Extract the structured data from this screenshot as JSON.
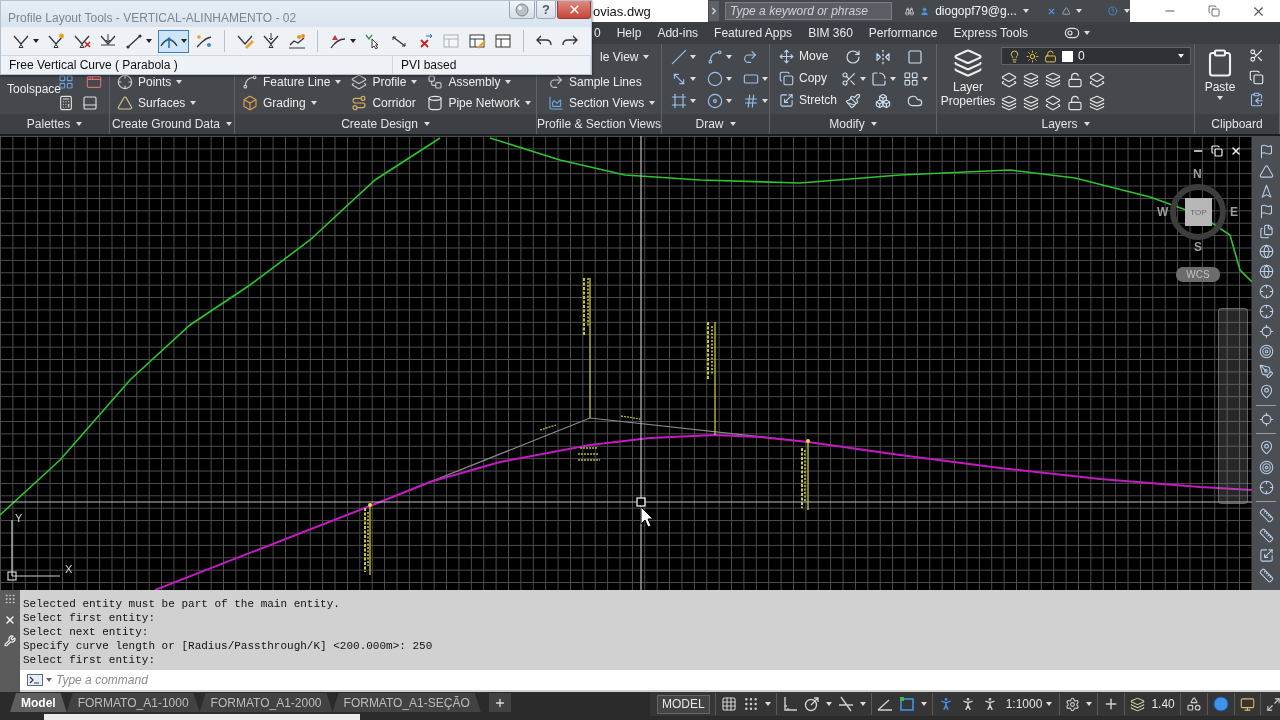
{
  "title_bar": {
    "file_name": "ovias.dwg",
    "search": {
      "placeholder": "Type a keyword or phrase"
    },
    "user": "diogopf79@g..."
  },
  "ribbon_tabs": [
    {
      "label": "0",
      "selected": false
    },
    {
      "label": "Help",
      "selected": false
    },
    {
      "label": "Add-ins",
      "selected": false
    },
    {
      "label": "Featured Apps",
      "selected": false
    },
    {
      "label": "BIM 360",
      "selected": false
    },
    {
      "label": "Performance",
      "selected": false
    },
    {
      "label": "Express Tools",
      "selected": false
    }
  ],
  "ribbon_panels": [
    {
      "kind": "palettes",
      "title": "Palettes",
      "menu": true,
      "items": [
        {
          "label": "Toolspace"
        }
      ]
    },
    {
      "kind": "columns",
      "title": "Create Ground Data",
      "menu": true,
      "columns": [
        [
          {
            "label": "Points",
            "dropdown": true
          },
          {
            "label": "Surfaces",
            "dropdown": true
          }
        ]
      ]
    },
    {
      "kind": "columns",
      "title": "Create Design",
      "menu": true,
      "columns": [
        [
          {
            "label": "Feature Line",
            "dropdown": true
          },
          {
            "label": "Grading",
            "dropdown": true
          }
        ],
        [
          {
            "label": "Profile",
            "dropdown": true
          },
          {
            "label": "Corridor",
            "dropdown": false
          }
        ],
        [
          {
            "label": "Assembly",
            "dropdown": true
          },
          {
            "label": "Pipe Network",
            "dropdown": true
          }
        ]
      ]
    },
    {
      "kind": "rows",
      "title": "Profile & Section Views",
      "menu": false,
      "items": [
        {
          "label": "le View",
          "dropdown": true
        },
        {
          "label": "Sample Lines",
          "dropdown": false
        },
        {
          "label": "Section Views",
          "dropdown": true
        }
      ]
    },
    {
      "kind": "draw",
      "title": "Draw",
      "menu": true
    },
    {
      "kind": "modify",
      "title": "Modify",
      "menu": true,
      "items": [
        {
          "label": "Move"
        },
        {
          "label": "Copy"
        },
        {
          "label": "Stretch"
        }
      ]
    },
    {
      "kind": "layers",
      "title": "Layers",
      "menu": true,
      "button": "Layer Properties",
      "current_layer": "0"
    },
    {
      "kind": "clipboard",
      "title": "Clipboard",
      "menu": false,
      "button": "Paste"
    }
  ],
  "profile_layout_tools": {
    "title": "Profile Layout Tools - VERTICAL-ALINHAMENTO - 02",
    "help": "?",
    "tool_groups": [
      [
        {
          "dropdown": true,
          "selected": false,
          "disabled": false
        },
        {
          "dropdown": false,
          "selected": false,
          "disabled": false
        },
        {
          "dropdown": false,
          "selected": false,
          "disabled": false
        },
        {
          "dropdown": false,
          "selected": false,
          "disabled": false
        },
        {
          "dropdown": true,
          "selected": false,
          "disabled": false
        },
        {
          "dropdown": true,
          "selected": true,
          "disabled": false
        },
        {
          "dropdown": false,
          "selected": false,
          "disabled": false
        }
      ],
      [
        {
          "dropdown": false,
          "selected": false,
          "disabled": false
        },
        {
          "dropdown": false,
          "selected": false,
          "disabled": false
        },
        {
          "dropdown": false,
          "selected": false,
          "disabled": false
        }
      ],
      [
        {
          "dropdown": true,
          "selected": false,
          "disabled": false
        },
        {
          "dropdown": false,
          "selected": false,
          "disabled": false
        },
        {
          "dropdown": false,
          "selected": false,
          "disabled": false
        },
        {
          "dropdown": false,
          "selected": false,
          "disabled": false
        },
        {
          "dropdown": false,
          "selected": false,
          "disabled": true
        },
        {
          "dropdown": false,
          "selected": false,
          "disabled": false
        },
        {
          "dropdown": false,
          "selected": false,
          "disabled": false
        }
      ],
      [
        {
          "dropdown": false,
          "selected": false,
          "disabled": false
        },
        {
          "dropdown": false,
          "selected": false,
          "disabled": false
        }
      ]
    ],
    "current_tool": "Free Vertical Curve ( Parabola )",
    "mode": "PVI based"
  },
  "viewport": {
    "view_cube": {
      "face": "TOP",
      "north": "N",
      "south": "S",
      "east": "E",
      "west": "W",
      "ucs": "WCS"
    },
    "ucs_icon": {
      "x_label": "X",
      "y_label": "Y"
    }
  },
  "command_line": {
    "history": [
      "Selected entity must be part of the main entity.",
      "Select first entity:",
      "Select next entity:",
      "Specify curve length or [Radius/Passthrough/K] <200.000m>: 250",
      "Select first entity:"
    ],
    "placeholder": "Type a command"
  },
  "layout_tabs": [
    {
      "label": "Model",
      "selected": true
    },
    {
      "label": "FORMATO_A1-1000",
      "selected": false
    },
    {
      "label": "FORMATO_A1-2000",
      "selected": false
    },
    {
      "label": "FORMATO_A1-SEÇÃO",
      "selected": false
    }
  ],
  "status_bar": {
    "space": "MODEL",
    "toggles": [
      {
        "on": false
      },
      {
        "on": false
      },
      {
        "on": false
      },
      {
        "on": false
      },
      {
        "on": false
      },
      {
        "on": false
      },
      {
        "on": true
      },
      {
        "on": true
      },
      {
        "on": false
      },
      {
        "on": false
      },
      {
        "on": false
      },
      {
        "on": true
      }
    ],
    "annotation_scale": "1:1000",
    "value": "1.40"
  }
}
